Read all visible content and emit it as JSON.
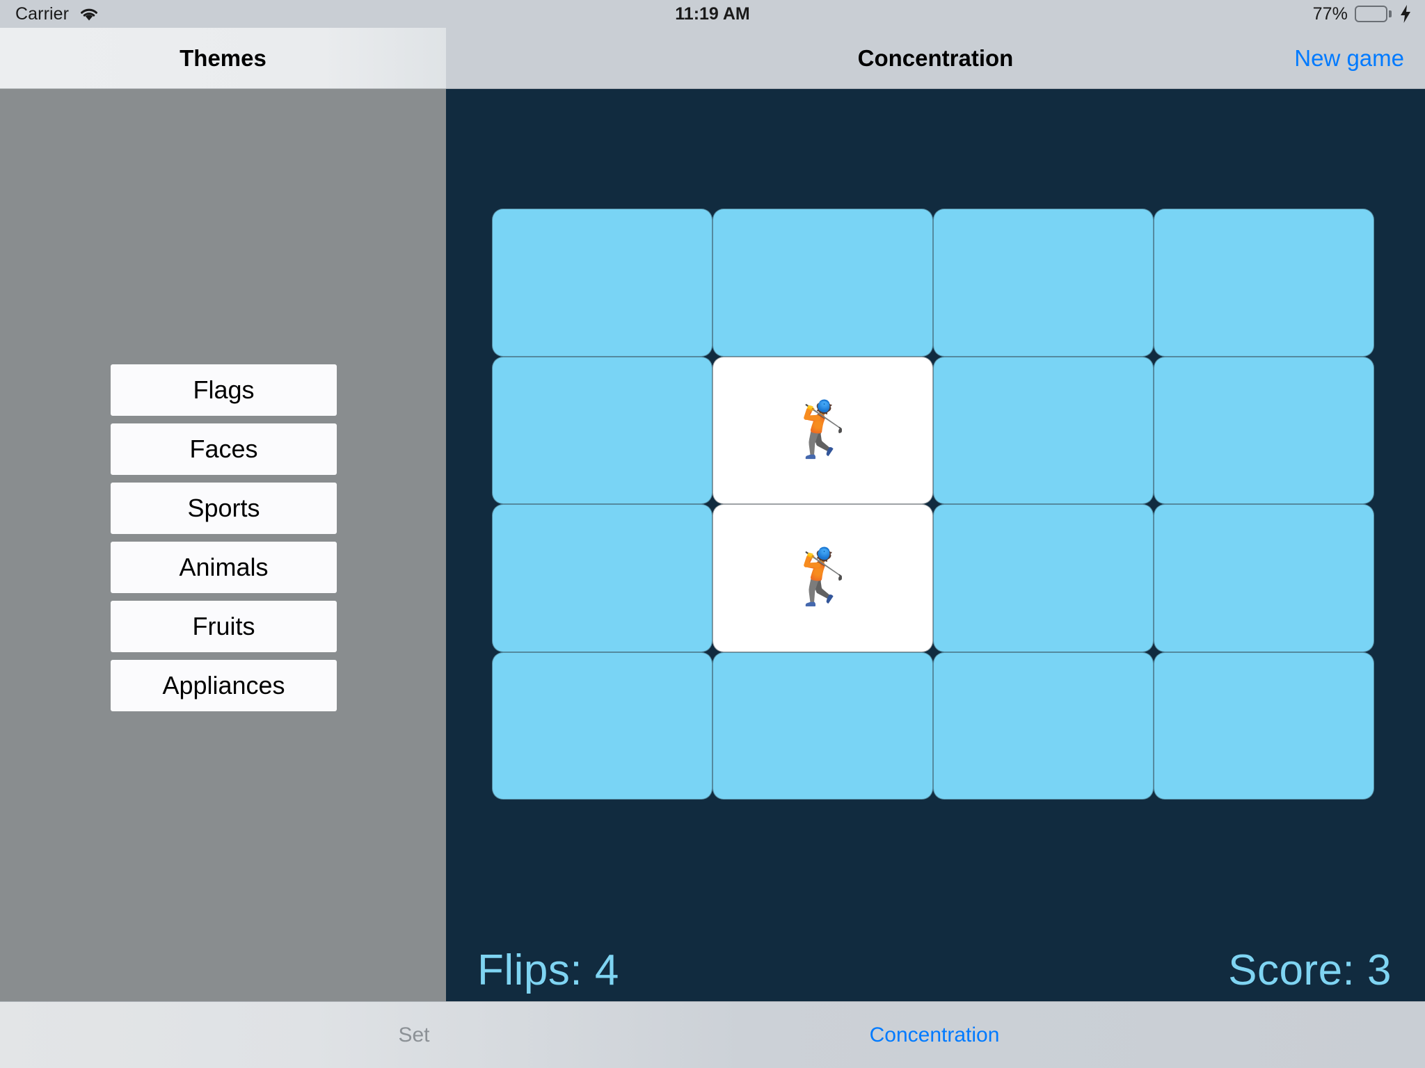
{
  "status_bar": {
    "carrier": "Carrier",
    "wifi_icon": "wifi-icon",
    "time": "11:19 AM",
    "battery_percent": "77%",
    "battery_icon": "battery-icon",
    "charging_icon": "lightning-bolt-icon",
    "battery_level": 77,
    "battery_color": "#4cd964"
  },
  "sidebar": {
    "title": "Themes",
    "background_color": "#898d8f",
    "themes": [
      {
        "label": "Flags"
      },
      {
        "label": "Faces"
      },
      {
        "label": "Sports"
      },
      {
        "label": "Animals"
      },
      {
        "label": "Fruits"
      },
      {
        "label": "Appliances"
      }
    ]
  },
  "detail": {
    "title": "Concentration",
    "new_game_label": "New game",
    "accent_color": "#007aff",
    "background_color": "#112b3f",
    "card_back_color": "#79d4f5",
    "card_face_color": "#ffffff",
    "grid": {
      "rows": 4,
      "columns": 4,
      "cards": [
        {
          "state": "facedown",
          "emoji": ""
        },
        {
          "state": "facedown",
          "emoji": ""
        },
        {
          "state": "facedown",
          "emoji": ""
        },
        {
          "state": "facedown",
          "emoji": ""
        },
        {
          "state": "facedown",
          "emoji": ""
        },
        {
          "state": "faceup",
          "emoji": "🏌️"
        },
        {
          "state": "facedown",
          "emoji": ""
        },
        {
          "state": "facedown",
          "emoji": ""
        },
        {
          "state": "facedown",
          "emoji": ""
        },
        {
          "state": "faceup",
          "emoji": "🏌️"
        },
        {
          "state": "facedown",
          "emoji": ""
        },
        {
          "state": "facedown",
          "emoji": ""
        },
        {
          "state": "facedown",
          "emoji": ""
        },
        {
          "state": "facedown",
          "emoji": ""
        },
        {
          "state": "facedown",
          "emoji": ""
        },
        {
          "state": "facedown",
          "emoji": ""
        }
      ]
    },
    "scoreboard": {
      "flips_text": "Flips: 4",
      "score_text": "Score: 3",
      "flips_value": 4,
      "score_value": 3,
      "text_color": "#7fd4f2"
    }
  },
  "tab_bar": {
    "tabs": [
      {
        "label": "Set",
        "active": false
      },
      {
        "label": "Concentration",
        "active": true
      }
    ],
    "active_color": "#007aff",
    "inactive_color": "#8c9196"
  }
}
